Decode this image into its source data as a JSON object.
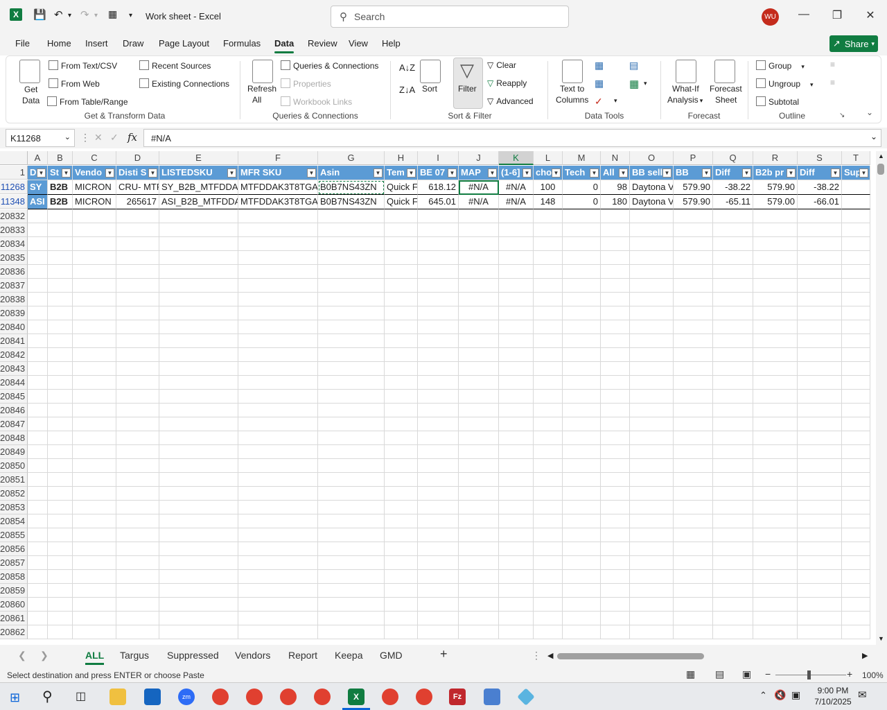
{
  "app": {
    "title": "Work sheet  -  Excel",
    "user_initials": "WU",
    "search_placeholder": "Search",
    "share_label": "Share"
  },
  "menu": [
    "File",
    "Home",
    "Insert",
    "Draw",
    "Page Layout",
    "Formulas",
    "Data",
    "Review",
    "View",
    "Help"
  ],
  "active_menu": "Data",
  "ribbon": {
    "get_data": "Get\nData",
    "from_text_csv": "From Text/CSV",
    "from_web": "From Web",
    "from_table_range": "From Table/Range",
    "recent_sources": "Recent Sources",
    "existing_connections": "Existing Connections",
    "group_get_transform": "Get & Transform Data",
    "refresh_all": "Refresh",
    "refresh_all2": "All",
    "queries_connections": "Queries & Connections",
    "properties": "Properties",
    "workbook_links": "Workbook Links",
    "group_queries": "Queries & Connections",
    "sort": "Sort",
    "filter": "Filter",
    "clear": "Clear",
    "reapply": "Reapply",
    "advanced": "Advanced",
    "group_sort_filter": "Sort & Filter",
    "text_to_columns": "Text to",
    "text_to_columns2": "Columns",
    "group_data_tools": "Data Tools",
    "what_if": "What-If",
    "what_if2": "Analysis",
    "forecast_sheet": "Forecast",
    "forecast_sheet2": "Sheet",
    "group_forecast": "Forecast",
    "group": "Group",
    "ungroup": "Ungroup",
    "subtotal": "Subtotal",
    "group_outline": "Outline"
  },
  "formula_bar": {
    "name_box": "K11268",
    "formula": "#N/A"
  },
  "columns": [
    "A",
    "B",
    "C",
    "D",
    "E",
    "F",
    "G",
    "H",
    "I",
    "J",
    "K",
    "L",
    "M",
    "N",
    "O",
    "P",
    "Q",
    "R",
    "S",
    "T"
  ],
  "selected_column": "K",
  "header_row": {
    "row_number": "1",
    "cells": [
      "D",
      "St",
      "Vendo",
      "Disti S",
      "LISTEDSKU",
      "MFR SKU",
      "Asin",
      "Tem",
      "BE 07",
      "MAP",
      "(1-6]",
      "cho",
      "Tech",
      "All",
      "BB sell",
      "BB",
      "Diff",
      "B2b pr",
      "Diff",
      "Sup"
    ]
  },
  "data_rows": [
    {
      "row_number": "11268",
      "cells": [
        "SY",
        "B2B",
        "MICRON",
        "CRU- MTF",
        "SY_B2B_MTFDDAK",
        "MTFDDAK3T8TGA-",
        "B0B7NS43ZN",
        "Quick F",
        "618.12",
        "#N/A",
        "#N/A",
        "100",
        "0",
        "98",
        "Daytona V",
        "579.90",
        "-38.22",
        "579.90",
        "-38.22",
        ""
      ]
    },
    {
      "row_number": "11348",
      "cells": [
        "ASI",
        "B2B",
        "MICRON",
        "265617",
        "ASI_B2B_MTFDDA",
        "MTFDDAK3T8TGA-",
        "B0B7NS43ZN",
        "Quick F",
        "645.01",
        "#N/A",
        "#N/A",
        "148",
        "0",
        "180",
        "Daytona V",
        "579.90",
        "-65.11",
        "579.00",
        "-66.01",
        ""
      ]
    }
  ],
  "empty_rows": [
    "20832",
    "20833",
    "20834",
    "20835",
    "20836",
    "20837",
    "20838",
    "20839",
    "20840",
    "20841",
    "20842",
    "20843",
    "20844",
    "20845",
    "20846",
    "20847",
    "20848",
    "20849",
    "20850",
    "20851",
    "20852",
    "20853",
    "20854",
    "20855",
    "20856",
    "20857",
    "20858",
    "20859",
    "20860",
    "20861",
    "20862"
  ],
  "sheet_tabs": [
    "ALL",
    "Targus",
    "Suppressed",
    "Vendors",
    "Report",
    "Keepa",
    "GMD"
  ],
  "active_sheet": "ALL",
  "status": {
    "message": "Select destination and press ENTER or choose Paste",
    "zoom": "100%"
  },
  "taskbar": {
    "time": "9:00 PM",
    "date": "7/10/2025"
  },
  "colors": {
    "accent": "#107c41",
    "header_fill": "#5b9bd5"
  }
}
